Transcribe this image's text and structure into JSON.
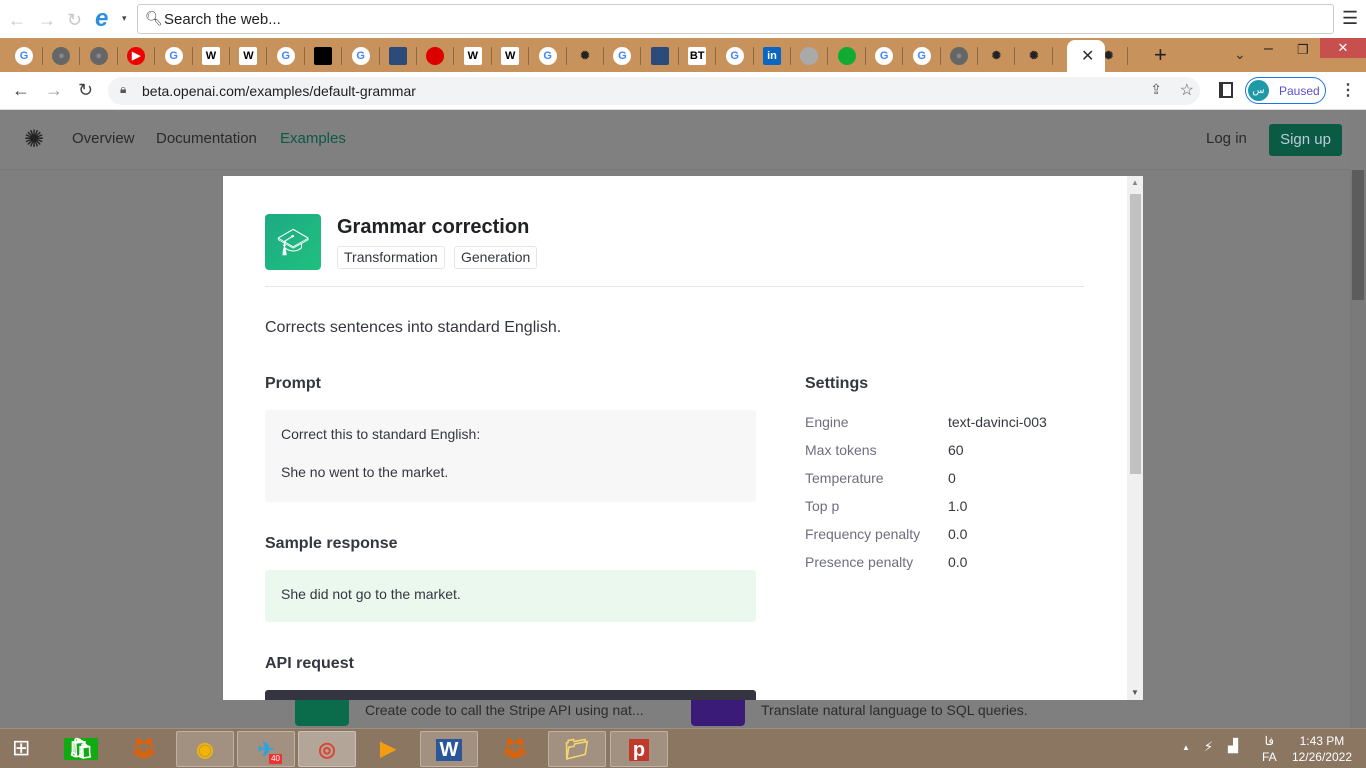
{
  "ie_toolbar": {
    "search_placeholder": "Search the web...",
    "icons": [
      "back-icon",
      "forward-icon",
      "refresh-icon",
      "ie-logo-icon",
      "menu-icon"
    ]
  },
  "tabs": {
    "favicons": [
      "google",
      "globe",
      "globe",
      "youtube",
      "google",
      "wikipedia",
      "wikipedia",
      "google",
      "medium",
      "google",
      "columns",
      "red-squares",
      "wikipedia",
      "wikipedia",
      "google",
      "openai",
      "google",
      "columns",
      "bt",
      "google",
      "linkedin",
      "a-logo",
      "green-circle",
      "google",
      "google",
      "globe",
      "openai",
      "openai",
      "active",
      "openai"
    ],
    "new_tab": "+",
    "labels": {
      "bt": "BT",
      "linkedin": "in",
      "wikipedia": "W",
      "google": "G"
    }
  },
  "chrome": {
    "url": "beta.openai.com/examples/default-grammar",
    "profile_initial": "س",
    "profile_status": "Paused"
  },
  "site_nav": {
    "items": [
      "Overview",
      "Documentation",
      "Examples"
    ],
    "active": "Examples",
    "login": "Log in",
    "signup": "Sign up"
  },
  "background_cards": [
    {
      "text": "Create code to call the Stripe API using nat...",
      "color": "#0b6c4c"
    },
    {
      "text": "Translate natural language to SQL queries.",
      "color": "#3a1c78"
    }
  ],
  "modal": {
    "title": "Grammar correction",
    "tags": [
      "Transformation",
      "Generation"
    ],
    "description": "Corrects sentences into standard English.",
    "prompt_heading": "Prompt",
    "prompt_lines": [
      "Correct this to standard English:",
      "She no went to the market."
    ],
    "response_heading": "Sample response",
    "response": "She did not go to the market.",
    "api_heading": "API request",
    "settings_heading": "Settings",
    "settings": [
      {
        "k": "Engine",
        "v": "text-davinci-003"
      },
      {
        "k": "Max tokens",
        "v": "60"
      },
      {
        "k": "Temperature",
        "v": "0"
      },
      {
        "k": "Top p",
        "v": "1.0"
      },
      {
        "k": "Frequency penalty",
        "v": "0.0"
      },
      {
        "k": "Presence penalty",
        "v": "0.0"
      }
    ],
    "accent": "#1fbf84"
  },
  "taskbar": {
    "apps": [
      "start",
      "store",
      "firefox",
      "browser-lock",
      "telegram",
      "chrome",
      "media-player",
      "word",
      "firefox",
      "file-explorer",
      "psiphon"
    ],
    "telegram_badge": "40",
    "word_label": "W",
    "psiphon_label": "p",
    "lang_top": "فا",
    "lang": "FA",
    "time": "1:43 PM",
    "date": "12/26/2022"
  }
}
